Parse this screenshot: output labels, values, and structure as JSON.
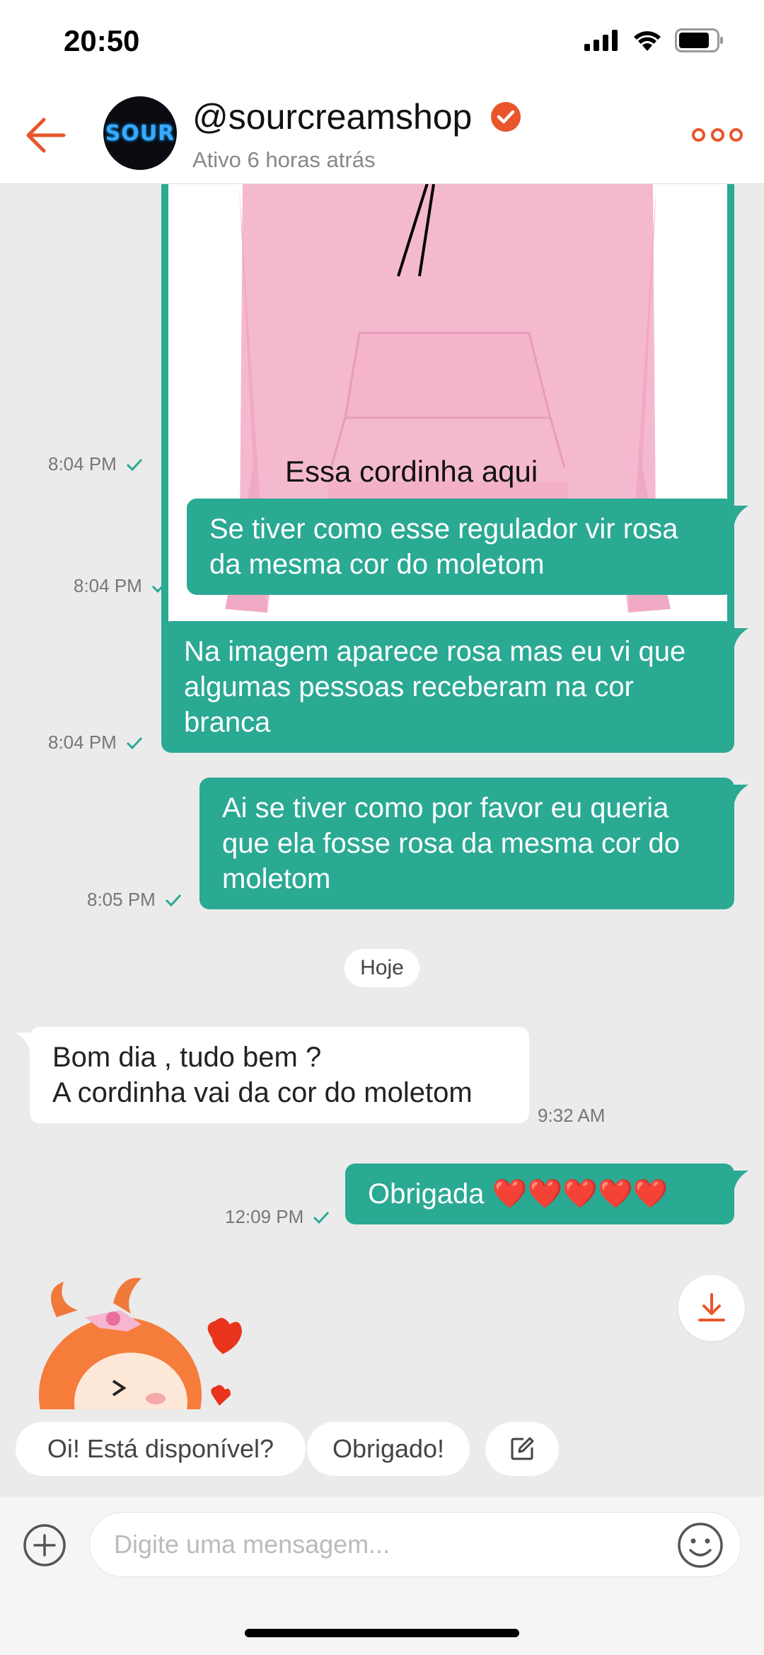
{
  "status_bar": {
    "time": "20:50"
  },
  "header": {
    "avatar_text": "SOUR",
    "shop_name": "@sourcreamshop",
    "shop_status": "Ativo 6 horas atrás"
  },
  "messages": [
    {
      "type": "image",
      "direction": "outgoing",
      "caption": "Essa cordinha aqui",
      "time": "8:04 PM"
    },
    {
      "type": "text",
      "direction": "outgoing",
      "lines": [
        "Se tiver como esse regulador vir rosa",
        "da mesma cor do moletom"
      ],
      "time": "8:04 PM"
    },
    {
      "type": "text",
      "direction": "outgoing",
      "lines": [
        "Na imagem aparece rosa mas eu vi que",
        "algumas pessoas receberam na cor",
        "branca"
      ],
      "time": "8:04 PM"
    },
    {
      "type": "text",
      "direction": "outgoing",
      "lines": [
        "Ai se tiver como por favor eu queria",
        "que ela fosse rosa da mesma cor do",
        "moletom"
      ],
      "time": "8:05 PM"
    },
    {
      "type": "date_separator",
      "label": "Hoje"
    },
    {
      "type": "text",
      "direction": "incoming",
      "lines": [
        "Bom dia , tudo bem ?",
        "A cordinha  vai da cor do moletom"
      ],
      "time": "9:32 AM"
    },
    {
      "type": "text",
      "direction": "outgoing",
      "lines": [
        "Obrigada ❤️❤️❤️❤️❤️"
      ],
      "time": "12:09 PM"
    },
    {
      "type": "sticker",
      "direction": "incoming"
    }
  ],
  "quick_replies": [
    "Oi! Está disponível?",
    "Obrigado!"
  ],
  "input": {
    "placeholder": "Digite uma mensagem..."
  },
  "colors": {
    "accent": "#e8562a",
    "bubble_out": "#2aa993",
    "bubble_in": "#ffffff",
    "chat_bg": "#ebebeb"
  },
  "icons": [
    "back-arrow-icon",
    "verified-icon",
    "more-icon",
    "checkmark-icon",
    "download-icon",
    "edit-icon",
    "plus-circle-icon",
    "emoji-icon"
  ]
}
